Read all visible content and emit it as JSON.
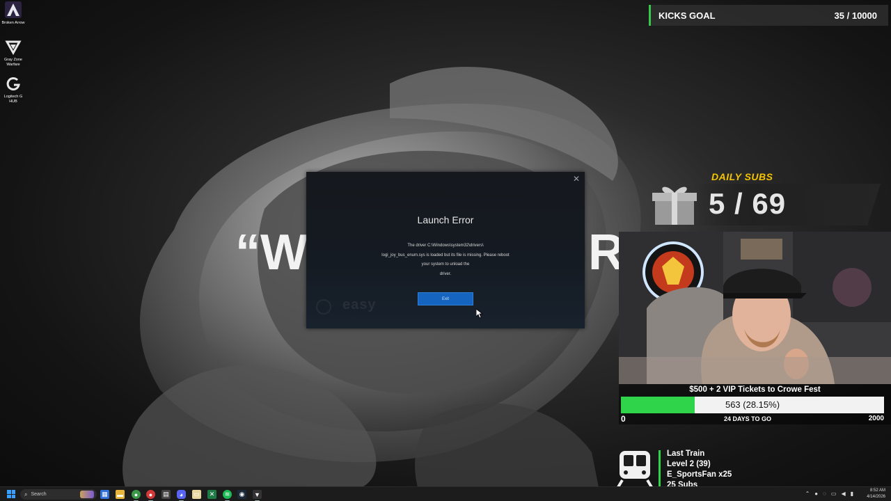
{
  "desktop": {
    "icons": [
      {
        "label": "Broken Arrow",
        "icon": "broken-arrow-icon"
      },
      {
        "label": "Gray Zone Warfare",
        "icon": "gray-zone-warfare-icon"
      },
      {
        "label": "Logitech G HUB",
        "icon": "logitech-g-hub-icon"
      }
    ]
  },
  "kicks_goal": {
    "label": "KICKS GOAL",
    "value": "35 / 10000",
    "accent": "#38c94a"
  },
  "background_text": {
    "left": "“W",
    "right": "R"
  },
  "dialog": {
    "title": "Launch Error",
    "message_lines": [
      "The driver C:\\Windows\\system32\\drivers\\",
      "logi_joy_bus_enum.sys is loaded but its file is missing. Please reboot",
      "your system to unload the",
      "driver."
    ],
    "exit_label": "Exit",
    "watermark": "easy",
    "close_icon": "close-icon",
    "accent": "#1565c0"
  },
  "daily_subs": {
    "label": "DAILY SUBS",
    "count": "5 / 69",
    "label_color": "#f5c400"
  },
  "goal": {
    "title": "$500 + 2 VIP Tickets to Crowe Fest",
    "value_text": "563 (28.15%)",
    "progress_fraction": 0.2815,
    "min": "0",
    "days_left": "24 DAYS TO GO",
    "max": "2000",
    "fill_color": "#30d44a"
  },
  "train": {
    "lines": [
      "Last Train",
      "Level 2  (39)",
      "E_SportsFan x25",
      "25 Subs"
    ]
  },
  "taskbar": {
    "search_placeholder": "Search",
    "time": "8:52 AM",
    "date": "4/14/2026"
  }
}
